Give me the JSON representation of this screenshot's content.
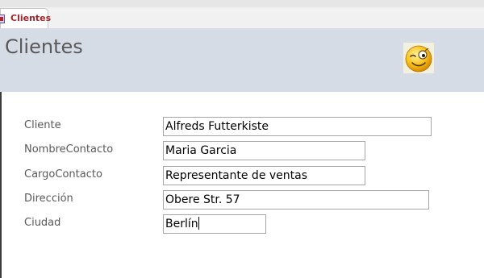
{
  "tab": {
    "label": "Clientes",
    "icon": "form-icon"
  },
  "header": {
    "title": "Clientes",
    "image": "winking-smiley-icon"
  },
  "fields": [
    {
      "label": "Cliente",
      "value": "Alfreds Futterkiste"
    },
    {
      "label": "NombreContacto",
      "value": "Maria Garcia"
    },
    {
      "label": "CargoContacto",
      "value": "Representante de ventas"
    },
    {
      "label": "Dirección",
      "value": "Obere Str. 57"
    },
    {
      "label": "Ciudad",
      "value": "Berlín"
    }
  ],
  "colors": {
    "tab_text": "#a4262c",
    "header_bg": "#d6dce5",
    "label_text": "#595959"
  }
}
